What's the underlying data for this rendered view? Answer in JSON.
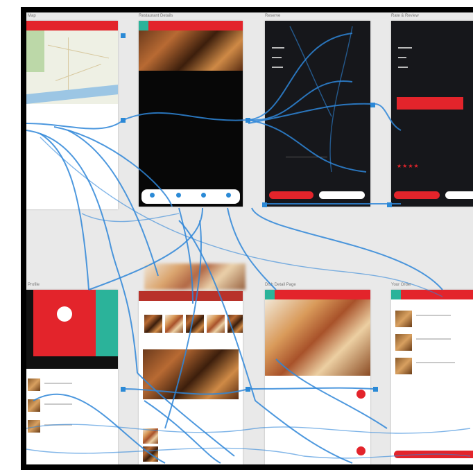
{
  "colors": {
    "accent": "#e3242b",
    "flow": "#2e86d8",
    "teal": "#2bb39a",
    "dark_screen": "#16171b"
  },
  "boards": {
    "map_screen": {
      "label": "Map",
      "title": ""
    },
    "restaurant_detail": {
      "label": "Restaurant Details",
      "title": "",
      "hero_caption": ""
    },
    "reserve_table": {
      "label": "Reserve",
      "title": "",
      "primary_button": "",
      "secondary_button": ""
    },
    "review": {
      "label": "Rate & Review",
      "title": "",
      "primary_button": "",
      "secondary_button": "",
      "rating_stars": "★★★★"
    },
    "profile": {
      "label": "Profile",
      "name": ""
    },
    "menu": {
      "label": "",
      "title": ""
    },
    "dish_detail": {
      "label": "Dish Detail Page",
      "title": ""
    },
    "order": {
      "label": "Your Order",
      "title": "",
      "checkout_button": ""
    }
  },
  "icons": [
    "map-icon",
    "fab-add-icon",
    "star-icon"
  ]
}
